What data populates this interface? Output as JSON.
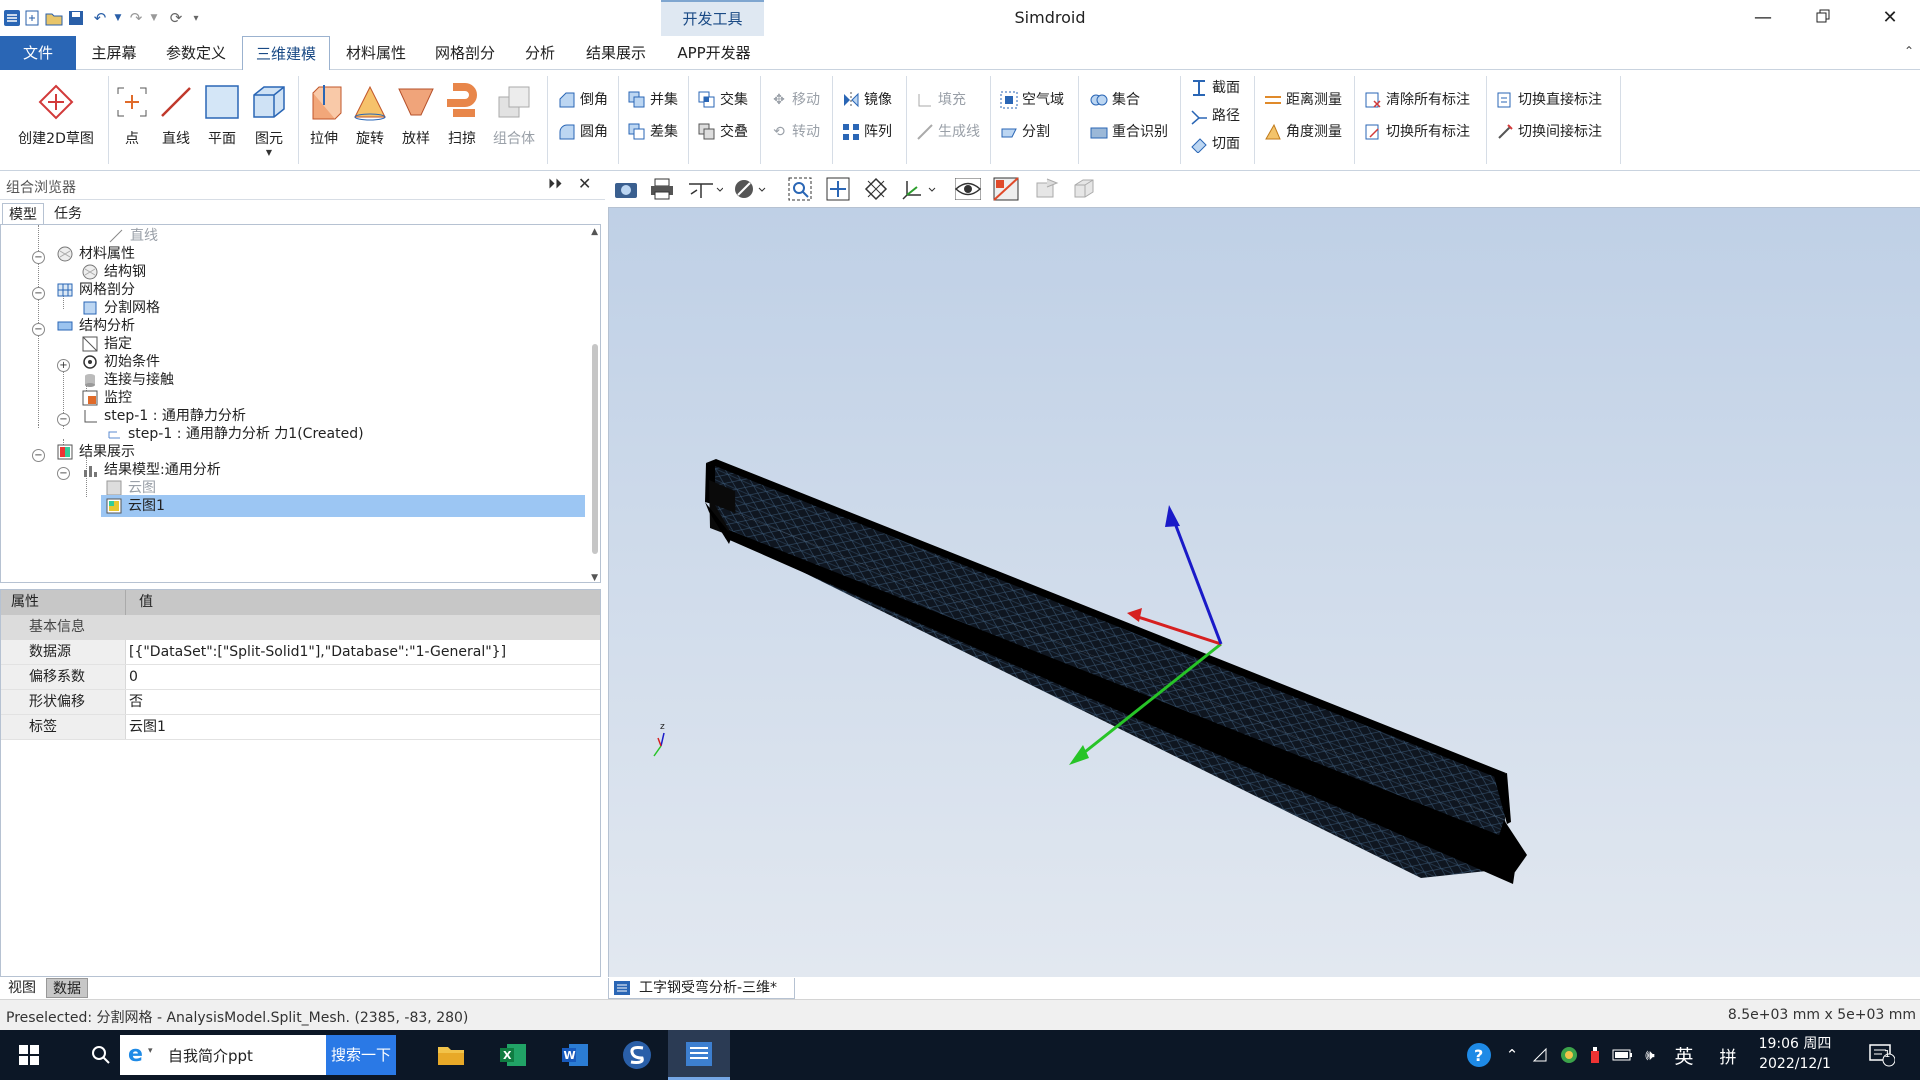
{
  "titlebar": {
    "title": "Simdroid",
    "context_tab": "开发工具",
    "quick_access": [
      "app-icon",
      "new-icon",
      "open-icon",
      "save-icon",
      "undo-icon",
      "redo-icon",
      "refresh-icon"
    ]
  },
  "menu": {
    "tabs": [
      "文件",
      "主屏幕",
      "参数定义",
      "三维建模",
      "材料属性",
      "网格剖分",
      "分析",
      "结果展示",
      "APP开发器"
    ],
    "active": "三维建模"
  },
  "ribbon": {
    "sketch": "创建2D草图",
    "primitives": [
      "点",
      "直线",
      "平面",
      "图元"
    ],
    "features": [
      "拉伸",
      "旋转",
      "放样",
      "扫掠",
      "组合体"
    ],
    "fillet": [
      "倒角",
      "圆角"
    ],
    "boolean1": [
      "并集",
      "差集"
    ],
    "boolean2": [
      "交集",
      "交叠"
    ],
    "transform": [
      "移动",
      "转动"
    ],
    "pattern": [
      "镜像",
      "阵列"
    ],
    "fill": [
      "填充",
      "生成线"
    ],
    "air": [
      "空气域",
      "分割"
    ],
    "sets": [
      "集合",
      "重合识别"
    ],
    "section": [
      "截面",
      "路径",
      "切面"
    ],
    "measure": [
      "距离测量",
      "角度测量"
    ],
    "annotation1": [
      "清除所有标注",
      "切换所有标注"
    ],
    "annotation2": [
      "切换直接标注",
      "切换间接标注"
    ]
  },
  "browser": {
    "title": "组合浏览器",
    "tabs": [
      "模型",
      "任务"
    ],
    "tree": [
      "直线",
      "材料属性",
      "结构钢",
      "网格剖分",
      "分割网格",
      "结构分析",
      "指定",
      "初始条件",
      "连接与接触",
      "监控",
      "step-1 : 通用静力分析",
      "step-1 : 通用静力分析 力1(Created)",
      "结果展示",
      "结果模型:通用分析",
      "云图",
      "云图1"
    ]
  },
  "properties": {
    "header": [
      "属性",
      "值"
    ],
    "group": "基本信息",
    "rows": [
      {
        "k": "数据源",
        "v": "[{\"DataSet\":[\"Split-Solid1\"],\"Database\":\"1-General\"}]"
      },
      {
        "k": "偏移系数",
        "v": "0"
      },
      {
        "k": "形状偏移",
        "v": "否"
      },
      {
        "k": "标签",
        "v": "云图1"
      }
    ]
  },
  "left_bottom_tabs": [
    "视图",
    "数据"
  ],
  "viewport": {
    "document_tab": "工字钢受弯分析-三维*",
    "axis_label_z": "z"
  },
  "status": {
    "left": "Preselected: 分割网格 - AnalysisModel.Split_Mesh. (2385, -83, 280)",
    "right": "8.5e+03 mm x 5e+03 mm"
  },
  "taskbar": {
    "search_text": "自我简介ppt",
    "search_button": "搜索一下",
    "apps": [
      "file-explorer-icon",
      "excel-icon",
      "word-icon",
      "simdroid-app-icon",
      "simdroid-doc-icon"
    ],
    "ime_lang": "英",
    "ime_mode": "拼",
    "time": "19:06 周四",
    "date": "2022/12/1",
    "notification_count": "1"
  },
  "colors": {
    "accent": "#2a66b5",
    "selection": "#9cc6f3",
    "viewport_top": "#bfd0e6",
    "viewport_bottom": "#e2e8f0",
    "taskbar": "#0c1726"
  }
}
